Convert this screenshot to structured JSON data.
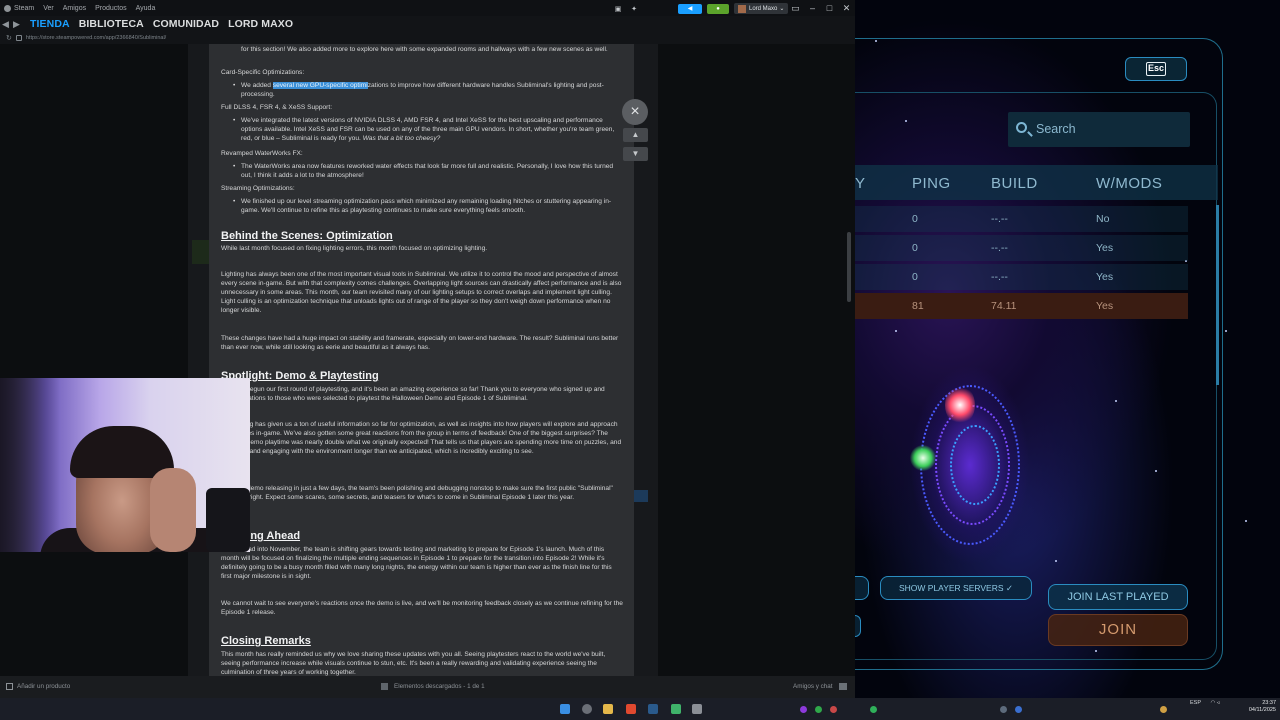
{
  "steam": {
    "menu": [
      "Steam",
      "Ver",
      "Amigos",
      "Productos",
      "Ayuda"
    ],
    "account_name": "Lord Maxo",
    "nav_tabs": [
      {
        "label": "TIENDA",
        "active": true
      },
      {
        "label": "BIBLIOTECA",
        "active": false
      },
      {
        "label": "COMUNIDAD",
        "active": false
      },
      {
        "label": "LORD MAXO",
        "active": false
      }
    ],
    "url": "https://store.steampowered.com/app/2366840/Subliminal/",
    "bottom": {
      "add_product": "Añadir un producto",
      "downloads": "Elementos descargados - 1 de 1",
      "friends_chat": "Amigos y chat"
    }
  },
  "article": {
    "p_top": "for this section! We also added more to explore here with some expanded rooms and hallways with a few new scenes as well.",
    "card_title": "Card-Specific Optimizations:",
    "card_sel": "several new GPU-specific optimi",
    "card_text": "zations to improve how different hardware handles Subliminal's lighting and post-processing.",
    "card_prefix": "We added ",
    "dlss_title": "Full DLSS 4, FSR 4, & XeSS Support:",
    "dlss_text": "We've integrated the latest versions of NVIDIA DLSS 4, AMD FSR 4, and Intel XeSS for the best upscaling and performance options available. Intel XeSS and FSR can be used on any of the three main GPU vendors. In short, whether you're team green, red, or blue – Subliminal is ready for you.",
    "dlss_italic": "Was that a bit too cheesy?",
    "water_title": "Revamped WaterWorks FX:",
    "water_text": "The WaterWorks area now features reworked water effects that look far more full and realistic. Personally, I love how this turned out, I think it adds a lot to the atmosphere!",
    "stream_title": "Streaming Optimizations:",
    "stream_text": "We finished up our level streaming optimization pass which minimized any remaining loading hitches or stuttering appearing in-game. We'll continue to refine this as playtesting continues to make sure everything feels smooth.",
    "h_behind": "Behind the Scenes: Optimization",
    "behind_1": "While last month focused on fixing lighting errors, this month focused on optimizing lighting.",
    "behind_2": "Lighting has always been one of the most important visual tools in Subliminal. We utilize it to control the mood and perspective of almost every scene in-game. But with that complexity comes challenges. Overlapping light sources can drastically affect performance and is also unnecessary in some areas. This month, our team revisited many of our lighting setups to correct overlaps and implement light culling. Light culling is an optimization technique that unloads lights out of range of the player so they don't weigh down performance when no longer visible.",
    "behind_3": "These changes have had a huge impact on stability and framerate, especially on lower-end hardware. The result? Subliminal runs better than ever now, while still looking as eerie and beautiful as it always has.",
    "h_spotlight": "Spotlight: Demo & Playtesting",
    "spot_1": "officially begun our first round of playtesting, and it's been an amazing experience so far! Thank you to everyone who signed up and congratulations to those who were selected to playtest the Halloween Demo and Episode 1 of Subliminal.",
    "spot_2": "Playtesting has given us a ton of useful information so far for optimization, as well as insights into how players will explore and approach the puzzles in-game. We've also gotten some great reactions from the group in terms of feedback! One of the biggest surprises? The average demo playtime was nearly double what we originally expected! That tells us that players are spending more time on puzzles, and exploring and engaging with the environment longer than we anticipated, which is incredibly exciting to see.",
    "spot_3": "With the demo releasing in just a few days, the team's been polishing and debugging nonstop to make sure the first public \"Subliminal\" feels just right. Expect some scares, some secrets, and teasers for what's to come in Subliminal Episode 1 later this year.",
    "h_ahead": "Looking Ahead",
    "ahead_1": "As we head into November, the team is shifting gears towards testing and marketing to prepare for Episode 1's launch. Much of this month will be focused on finalizing the multiple ending sequences in Episode 1 to prepare for the transition into Episode 2! While it's definitely going to be a busy month filled with many long nights, the energy within our team is higher than ever as the finish line for this first major milestone is in sight.",
    "ahead_2": "We cannot wait to see everyone's reactions once the demo is live, and we'll be monitoring feedback closely as we continue refining for the Episode 1 release.",
    "h_closing": "Closing Remarks",
    "closing_1": "This month has really reminded us why we love sharing these updates with you all. Seeing playtesters react to the world we've built, seeing performance increase while visuals continue to stun, etc. It's been a really rewarding and validating experience seeing the culmination of three years of working together.",
    "close_icon": "×",
    "prev_icon": "▲",
    "next_icon": "▼"
  },
  "game": {
    "esc_label": "Esc",
    "search_placeholder": "Search",
    "columns": [
      "Y",
      "PING",
      "BUILD",
      "W/MODS"
    ],
    "rows": [
      {
        "ping": "0",
        "build": "--.--",
        "mods": "No"
      },
      {
        "ping": "0",
        "build": "--.--",
        "mods": "Yes"
      },
      {
        "ping": "0",
        "build": "--.--",
        "mods": "Yes"
      },
      {
        "ping": "81",
        "build": "74.11",
        "mods": "Yes"
      }
    ],
    "show_player_servers": "SHOW PLAYER SERVERS",
    "join_last_played": "JOIN LAST PLAYED",
    "join": "JOIN"
  },
  "taskbar": {
    "lang": "ESP",
    "time": "23:37",
    "date": "04/11/2025"
  },
  "colors": {
    "steam_accent": "#1a9fff",
    "game_accent": "#2a8cc0",
    "highlight_row": "#3a1c12"
  }
}
